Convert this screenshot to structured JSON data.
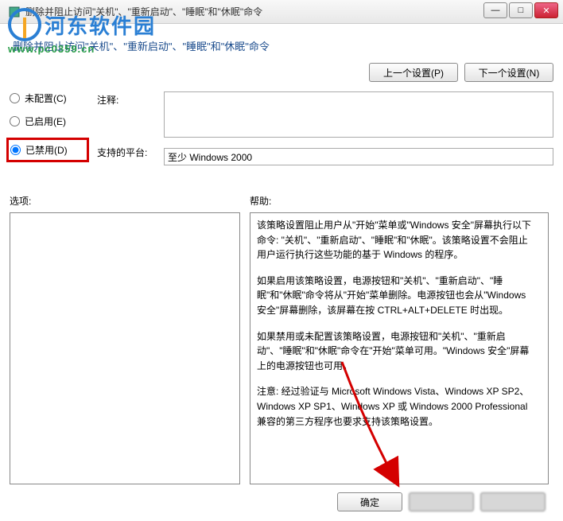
{
  "titlebar": {
    "title": "删除并阻止访问\"关机\"、\"重新启动\"、\"睡眠\"和\"休眠\"命令"
  },
  "watermark": {
    "line1": "河东软件园",
    "line2": "www.pc0359.cn"
  },
  "subtitle": "删除并阻止访问\"关机\"、\"重新启动\"、\"睡眠\"和\"休眠\"命令",
  "nav": {
    "prev": "上一个设置(P)",
    "next": "下一个设置(N)"
  },
  "radios": {
    "not_configured": "未配置(C)",
    "enabled": "已启用(E)",
    "disabled": "已禁用(D)",
    "selected": "disabled"
  },
  "labels": {
    "comment": "注释:",
    "platform": "支持的平台:",
    "options": "选项:",
    "help": "帮助:"
  },
  "fields": {
    "comment": "",
    "platform": "至少 Windows 2000"
  },
  "help": {
    "p1": "该策略设置阻止用户从\"开始\"菜单或\"Windows 安全\"屏幕执行以下命令: \"关机\"、\"重新启动\"、\"睡眠\"和\"休眠\"。该策略设置不会阻止用户运行执行这些功能的基于 Windows 的程序。",
    "p2": "如果启用该策略设置，电源按钮和\"关机\"、\"重新启动\"、\"睡眠\"和\"休眠\"命令将从\"开始\"菜单删除。电源按钮也会从\"Windows 安全\"屏幕删除，该屏幕在按 CTRL+ALT+DELETE 时出现。",
    "p3": "如果禁用或未配置该策略设置，电源按钮和\"关机\"、\"重新启动\"、\"睡眠\"和\"休眠\"命令在\"开始\"菜单可用。\"Windows 安全\"屏幕上的电源按钮也可用。",
    "p4": "注意: 经过验证与 Microsoft Windows Vista、Windows XP SP2、Windows XP SP1、Windows XP 或 Windows 2000 Professional 兼容的第三方程序也要求支持该策略设置。"
  },
  "footer": {
    "ok": "确定",
    "cancel": "",
    "apply": ""
  }
}
